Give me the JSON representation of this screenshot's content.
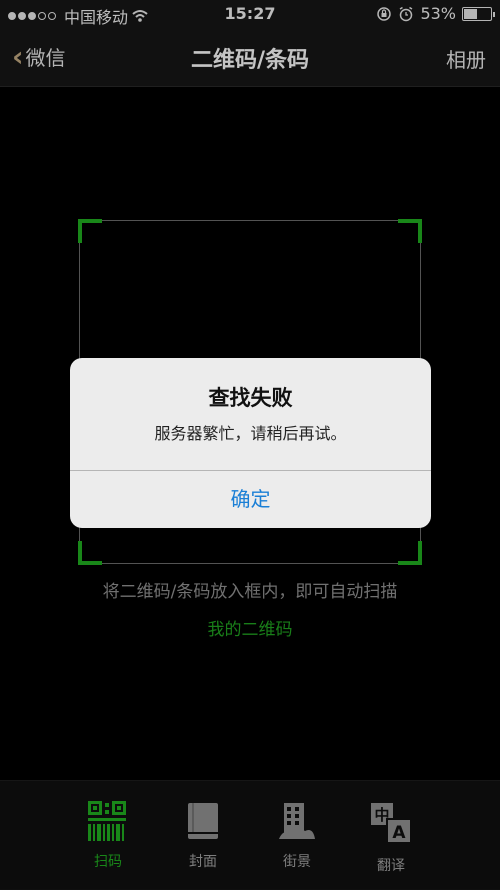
{
  "status": {
    "carrier": "中国移动",
    "time": "15:27",
    "battery_pct": "53%",
    "battery_level": 0.53
  },
  "nav": {
    "back_label": "微信",
    "title": "二维码/条码",
    "album_label": "相册"
  },
  "scanner": {
    "hint": "将二维码/条码放入框内，即可自动扫描",
    "my_code_link": "我的二维码"
  },
  "alert": {
    "title": "查找失败",
    "message": "服务器繁忙，请稍后再试。",
    "confirm_label": "确定"
  },
  "tabs": [
    {
      "label": "扫码",
      "icon": "qr-scan-icon",
      "active": true
    },
    {
      "label": "封面",
      "icon": "book-cover-icon",
      "active": false
    },
    {
      "label": "街景",
      "icon": "street-view-icon",
      "active": false
    },
    {
      "label": "翻译",
      "icon": "translate-icon",
      "active": false
    }
  ],
  "colors": {
    "accent_green": "#1fa51f",
    "alert_button_blue": "#1a7fd6"
  }
}
